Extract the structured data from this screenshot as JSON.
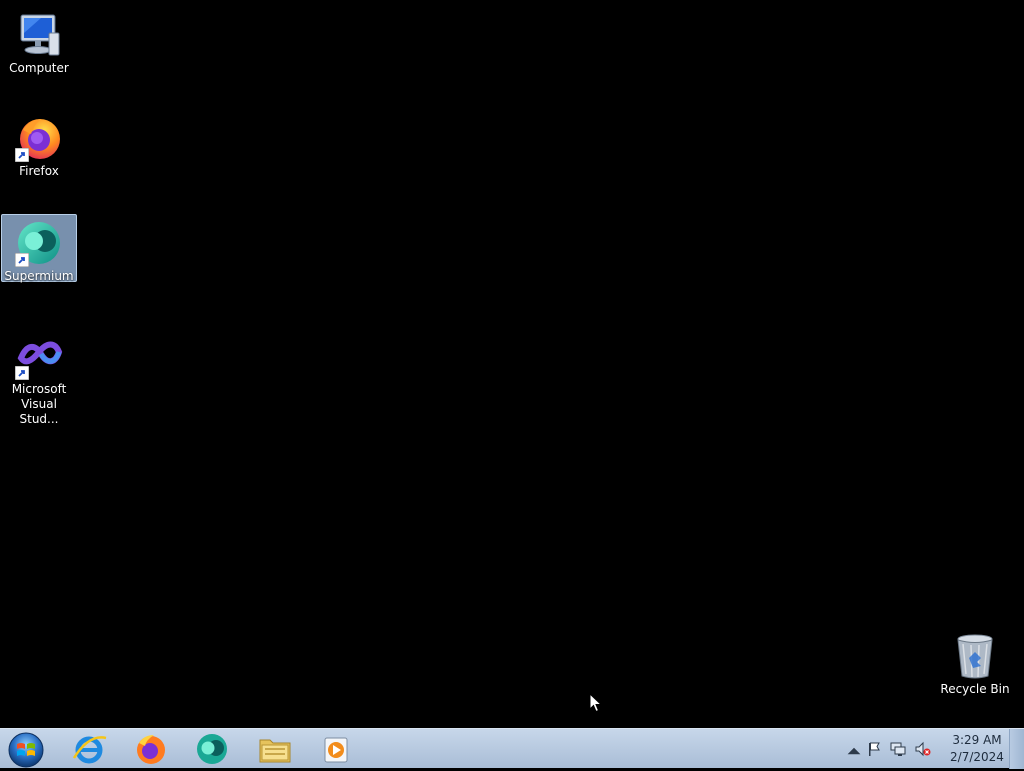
{
  "desktop": {
    "icons": [
      {
        "label": "Computer",
        "icon": "computer-icon"
      },
      {
        "label": "Firefox",
        "icon": "firefox-icon"
      },
      {
        "label": "Supermium",
        "icon": "supermium-icon",
        "selected": true
      },
      {
        "label": "Microsoft\nVisual Stud...",
        "icon": "visual-studio-icon"
      },
      {
        "label": "Recycle Bin",
        "icon": "recycle-bin-icon"
      }
    ]
  },
  "taskbar": {
    "start": {
      "icon": "windows-start-icon"
    },
    "pinned": [
      {
        "icon": "internet-explorer-icon"
      },
      {
        "icon": "firefox-icon"
      },
      {
        "icon": "supermium-icon"
      },
      {
        "icon": "file-explorer-icon"
      },
      {
        "icon": "media-player-icon"
      }
    ],
    "tray": {
      "icons": [
        "show-hidden-icons-arrow",
        "action-center-flag-icon",
        "network-icon",
        "volume-muted-icon"
      ],
      "time": "3:29 AM",
      "date": "2/7/2024"
    }
  },
  "colors": {
    "desktop_background": "#000000",
    "taskbar": "#b7c9df",
    "selection": "#9ab8de"
  }
}
